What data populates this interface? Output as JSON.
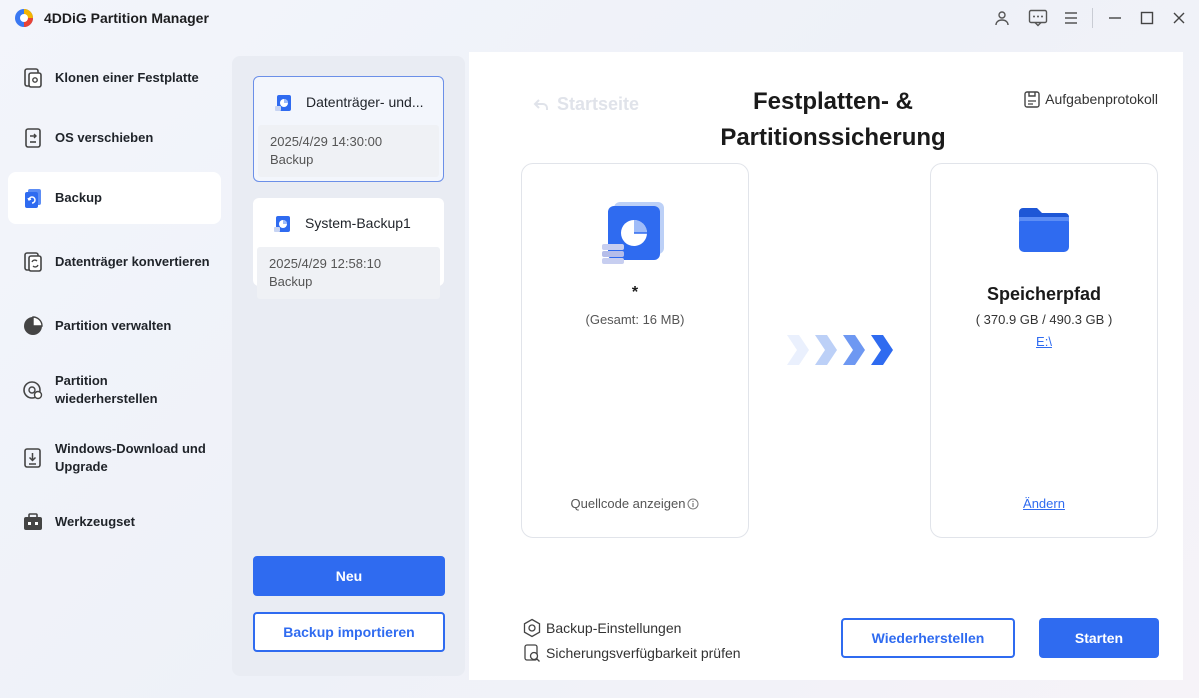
{
  "app": {
    "title": "4DDiG Partition Manager"
  },
  "titlebar": {
    "icons": [
      "user-icon",
      "feedback-icon",
      "menu-icon",
      "minimize-icon",
      "maximize-icon",
      "close-icon"
    ]
  },
  "sidebar": {
    "items": [
      {
        "label": "Klonen einer Festplatte",
        "icon": "clone-disk-icon",
        "active": false
      },
      {
        "label": "OS verschieben",
        "icon": "os-migrate-icon",
        "active": false
      },
      {
        "label": "Backup",
        "icon": "backup-icon",
        "active": true
      },
      {
        "label": "Datenträger konvertieren",
        "icon": "convert-disk-icon",
        "active": false
      },
      {
        "label": "Partition verwalten",
        "icon": "pie-chart-icon",
        "active": false
      },
      {
        "label": "Partition wiederherstellen",
        "icon": "partition-recovery-icon",
        "active": false
      },
      {
        "label": "Windows-Download und Upgrade",
        "icon": "windows-download-icon",
        "active": false
      },
      {
        "label": "Werkzeugset",
        "icon": "toolbox-icon",
        "active": false
      }
    ]
  },
  "backups": [
    {
      "title": "Datenträger- und...",
      "date": "2025/4/29 14:30:00",
      "type": "Backup",
      "selected": true
    },
    {
      "title": "System-Backup1",
      "date": "2025/4/29 12:58:10",
      "type": "Backup",
      "selected": false
    }
  ],
  "list_buttons": {
    "new": "Neu",
    "import": "Backup importieren"
  },
  "main": {
    "home": "Startseite",
    "title": "Festplatten- & Partitionssicherung",
    "task_log": "Aufgabenprotokoll",
    "source": {
      "name": "*",
      "total": "(Gesamt: 16 MB)",
      "view_code": "Quellcode anzeigen"
    },
    "target": {
      "name": "Speicherpfad",
      "size": "( 370.9 GB / 490.3 GB )",
      "path": "E:\\",
      "change": "Ändern"
    },
    "options": {
      "settings": "Backup-Einstellungen",
      "check": "Sicherungsverfügbarkeit prüfen"
    },
    "buttons": {
      "restore": "Wiederherstellen",
      "start": "Starten"
    }
  },
  "colors": {
    "accent": "#2f6bf0",
    "panel": "#e9ecf3"
  }
}
